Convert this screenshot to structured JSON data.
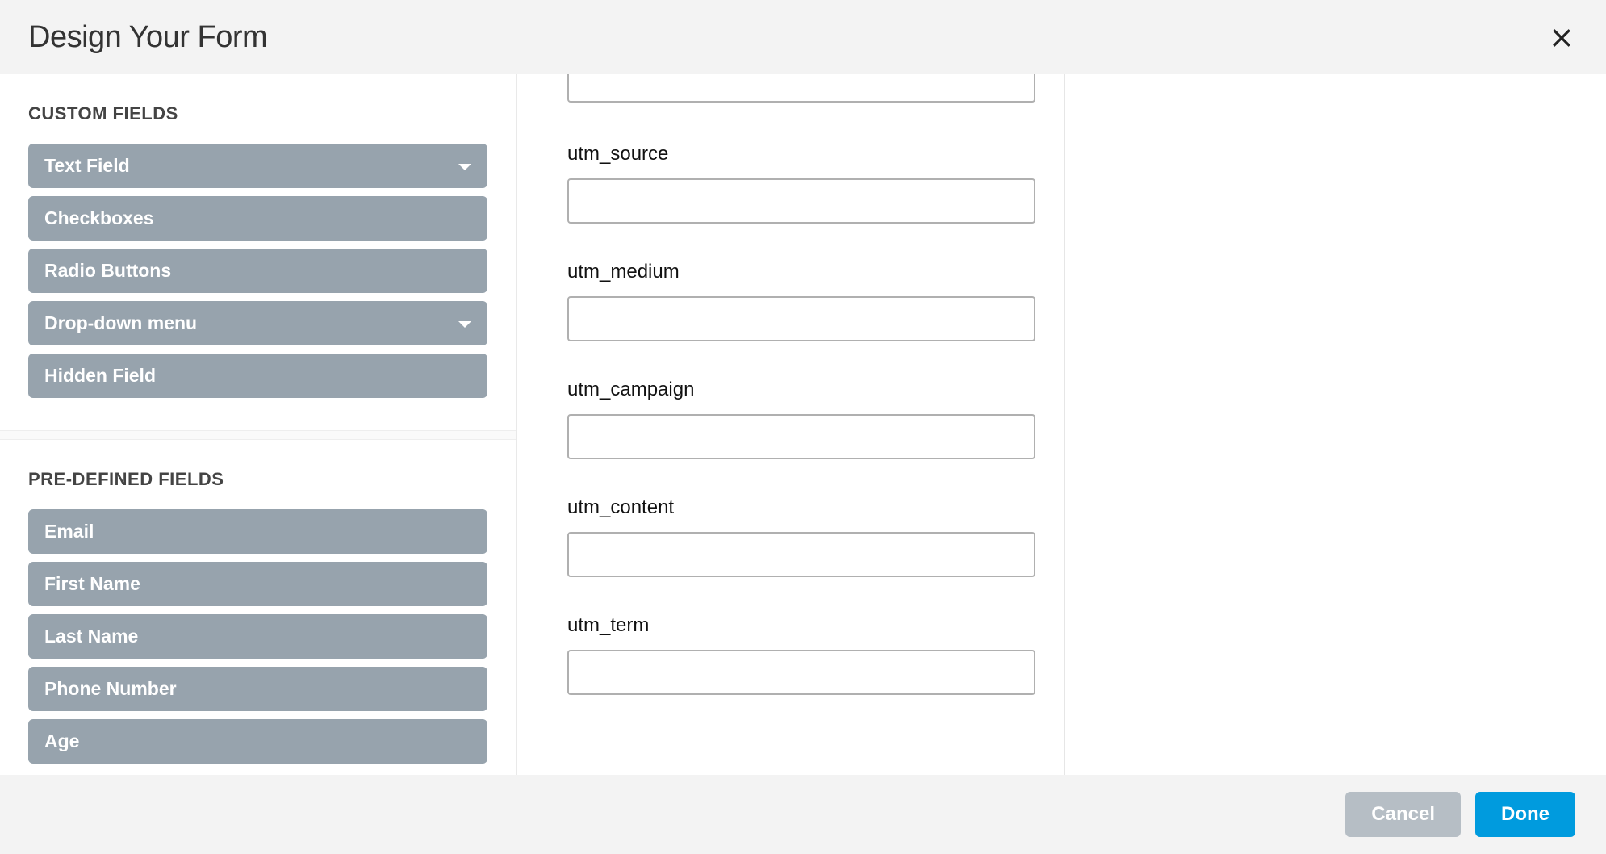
{
  "header": {
    "title": "Design Your Form"
  },
  "sidebar": {
    "sections": [
      {
        "title": "CUSTOM FIELDS",
        "items": [
          {
            "label": "Text Field",
            "has_caret": true
          },
          {
            "label": "Checkboxes",
            "has_caret": false
          },
          {
            "label": "Radio Buttons",
            "has_caret": false
          },
          {
            "label": "Drop-down menu",
            "has_caret": true
          },
          {
            "label": "Hidden Field",
            "has_caret": false
          }
        ]
      },
      {
        "title": "PRE-DEFINED FIELDS",
        "items": [
          {
            "label": "Email",
            "has_caret": false
          },
          {
            "label": "First Name",
            "has_caret": false
          },
          {
            "label": "Last Name",
            "has_caret": false
          },
          {
            "label": "Phone Number",
            "has_caret": false
          },
          {
            "label": "Age",
            "has_caret": false
          }
        ]
      }
    ]
  },
  "preview": {
    "fields": [
      {
        "label": "utm_source",
        "value": ""
      },
      {
        "label": "utm_medium",
        "value": ""
      },
      {
        "label": "utm_campaign",
        "value": ""
      },
      {
        "label": "utm_content",
        "value": ""
      },
      {
        "label": "utm_term",
        "value": ""
      }
    ]
  },
  "footer": {
    "cancel_label": "Cancel",
    "done_label": "Done"
  },
  "colors": {
    "pill_bg": "#97a3ad",
    "done_bg": "#009bde",
    "cancel_bg": "#b6bec5",
    "header_bg": "#f3f3f3"
  }
}
